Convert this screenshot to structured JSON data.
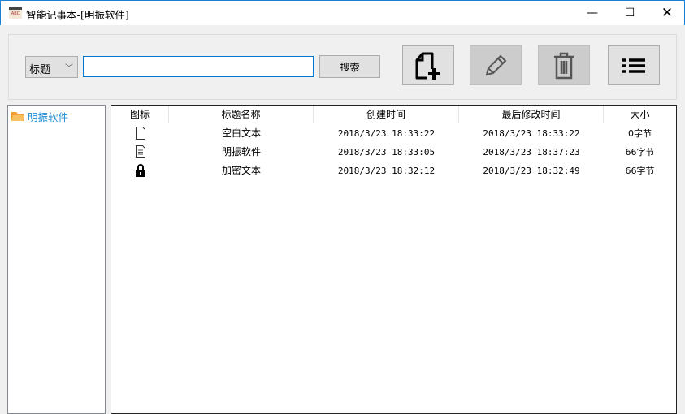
{
  "window": {
    "title": "智能记事本-[明振软件]"
  },
  "toolbar": {
    "search_field": "标题",
    "search_value": "",
    "search_label": "搜索",
    "buttons": [
      "new-note",
      "edit",
      "delete",
      "list"
    ]
  },
  "tree": {
    "items": [
      {
        "label": "明振软件"
      }
    ]
  },
  "list": {
    "columns": [
      "图标",
      "标题名称",
      "创建时间",
      "最后修改时间",
      "大小"
    ],
    "rows": [
      {
        "icon": "blank-file-icon",
        "title": "空白文本",
        "created": "2018/3/23 18:33:22",
        "modified": "2018/3/23 18:33:22",
        "size": "0字节"
      },
      {
        "icon": "text-file-icon",
        "title": "明振软件",
        "created": "2018/3/23 18:33:05",
        "modified": "2018/3/23 18:37:23",
        "size": "66字节"
      },
      {
        "icon": "lock-icon",
        "title": "加密文本",
        "created": "2018/3/23 18:32:12",
        "modified": "2018/3/23 18:32:49",
        "size": "66字节"
      }
    ]
  }
}
